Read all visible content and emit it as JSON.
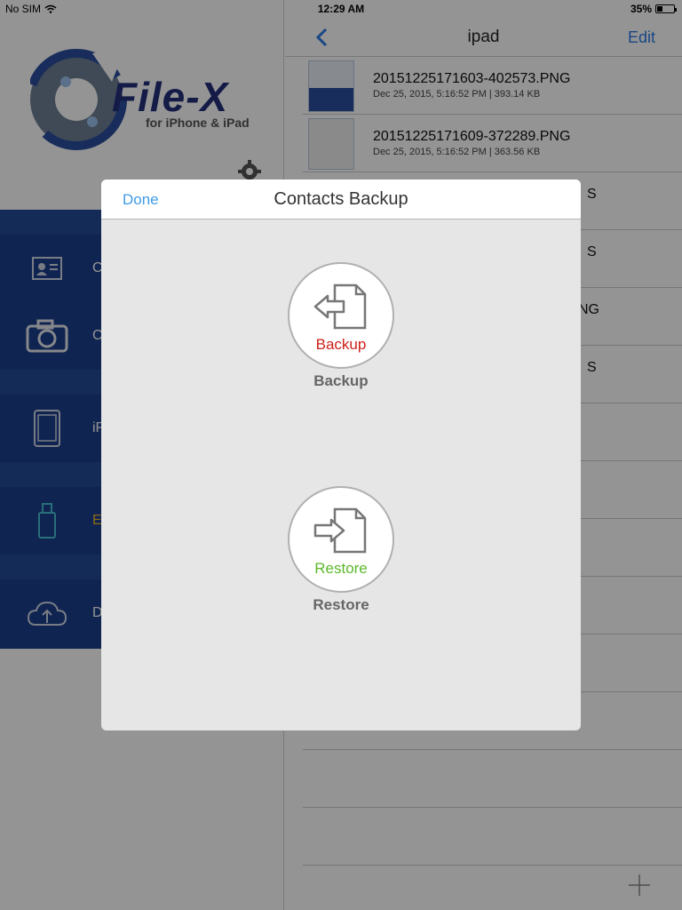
{
  "status_bar": {
    "carrier": "No SIM",
    "time": "12:29 AM",
    "battery": "35%",
    "battery_level": 0.35
  },
  "sidebar": {
    "logo": {
      "word": "File-X",
      "subtitle": "for iPhone & iPad"
    },
    "menu": [
      {
        "label": "C",
        "icon": "contact-card-icon"
      },
      {
        "label": "C",
        "icon": "camera-icon"
      },
      {
        "label": "iP",
        "icon": "ipad-icon"
      },
      {
        "label": "E",
        "icon": "usb-drive-icon",
        "color": "#f0b82a"
      },
      {
        "label": "D",
        "icon": "cloud-upload-icon"
      }
    ]
  },
  "file_browser": {
    "title": "ipad",
    "edit_label": "Edit",
    "files": [
      {
        "name": "20151225171603-402573.PNG",
        "meta": "Dec 25, 2015, 5:16:52 PM | 393.14 KB"
      },
      {
        "name": "20151225171609-372289.PNG",
        "meta": "Dec 25, 2015, 5:16:52 PM | 363.56 KB"
      },
      {
        "name": "S",
        "meta": ""
      },
      {
        "name": "S",
        "meta": ""
      },
      {
        "name": "NG",
        "meta": ""
      },
      {
        "name": "S",
        "meta": ""
      }
    ]
  },
  "modal": {
    "title": "Contacts Backup",
    "done_label": "Done",
    "backup": {
      "inner_label": "Backup",
      "caption": "Backup",
      "label_color": "#d0201a"
    },
    "restore": {
      "inner_label": "Restore",
      "caption": "Restore",
      "label_color": "#5cb82a"
    }
  },
  "colors": {
    "accent": "#2c7be5",
    "sidebar_blue": "#1c3f8c",
    "done_blue": "#3f9be6"
  }
}
